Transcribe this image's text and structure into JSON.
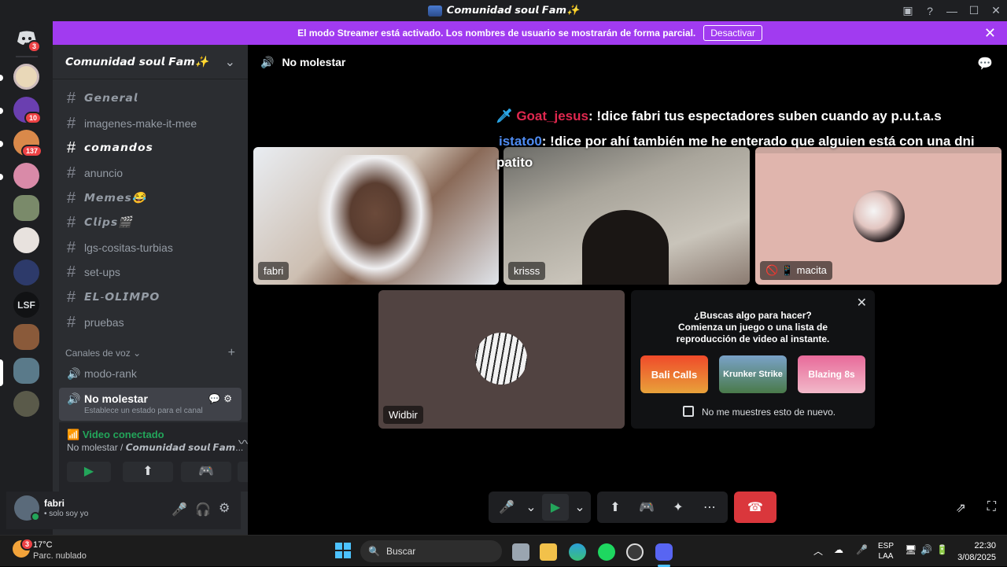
{
  "window": {
    "title": "𝘾𝙤𝙢𝙪𝙣𝙞𝙙𝙖𝙙 𝙨𝙤𝙪𝙡 𝙁𝙖𝙢✨"
  },
  "streamer_banner": {
    "text": "El modo Streamer está activado. Los nombres de usuario se mostrarán de forma parcial.",
    "button": "Desactivar"
  },
  "guilds": {
    "home_badge": "3",
    "badges": [
      "10",
      "137"
    ],
    "text_server": "LSF"
  },
  "server": {
    "name": "𝘾𝙤𝙢𝙪𝙣𝙞𝙙𝙖𝙙 𝙨𝙤𝙪𝙡 𝙁𝙖𝙢✨"
  },
  "channels": [
    {
      "label": "𝙂𝙚𝙣𝙚𝙧𝙖𝙡"
    },
    {
      "label": "imagenes-make-it-mee"
    },
    {
      "label": "𝙘𝙤𝙢𝙖𝙣𝙙𝙤𝙨"
    },
    {
      "label": "anuncio"
    },
    {
      "label": "𝙈𝙚𝙢𝙚𝙨😂"
    },
    {
      "label": "𝘾𝙡𝙞𝙥𝙨🎬"
    },
    {
      "label": "lgs-cositas-turbias"
    },
    {
      "label": "set-ups"
    },
    {
      "label": "𝙀𝙇-𝙊𝙇𝙄𝙈𝙋𝙊"
    },
    {
      "label": "pruebas"
    }
  ],
  "voice": {
    "category": "Canales de voz",
    "channels": [
      "modo-rank",
      "No molestar"
    ],
    "status_hint": "Establece un estado para el canal"
  },
  "voice_panel": {
    "status": "Video conectado",
    "location": "No molestar / 𝘾𝙤𝙢𝙪𝙣𝙞𝙙𝙖𝙙 𝙨𝙤𝙪𝙡 𝙁𝙖𝙢..."
  },
  "user": {
    "name": "fabri",
    "status": "• solo soy yo"
  },
  "call": {
    "channel_title": "No molestar",
    "chat": [
      {
        "user": "Goat_jesus",
        "text": ": !dice fabri tus espectadores suben cuando ay p.u.t.a.s"
      },
      {
        "user": "istato0",
        "text": ": !dice por ahí también me he enterado que alguien está con una dni"
      },
      {
        "user": "",
        "text": "patito"
      }
    ],
    "participants": [
      "fabri",
      "krisss",
      "macita",
      "Widbir"
    ],
    "activity": {
      "title": "¿Buscas algo para hacer?",
      "body": "Comienza un juego o una lista de reproducción de video al instante.",
      "checkbox": "No me muestres esto de nuevo.",
      "games": [
        "Bali Calls",
        "Krunker Strike",
        "Blazing 8s"
      ]
    }
  },
  "taskbar": {
    "weather_temp": "17°C",
    "weather_desc": "Parc. nublado",
    "weather_badge": "3",
    "search": "Buscar",
    "lang1": "ESP",
    "lang2": "LAA",
    "time": "22:30",
    "date": "3/08/2025"
  },
  "colors": {
    "accent": "#5865f2",
    "streamer": "#a13bf0",
    "green": "#23a55a",
    "red": "#da373c"
  }
}
